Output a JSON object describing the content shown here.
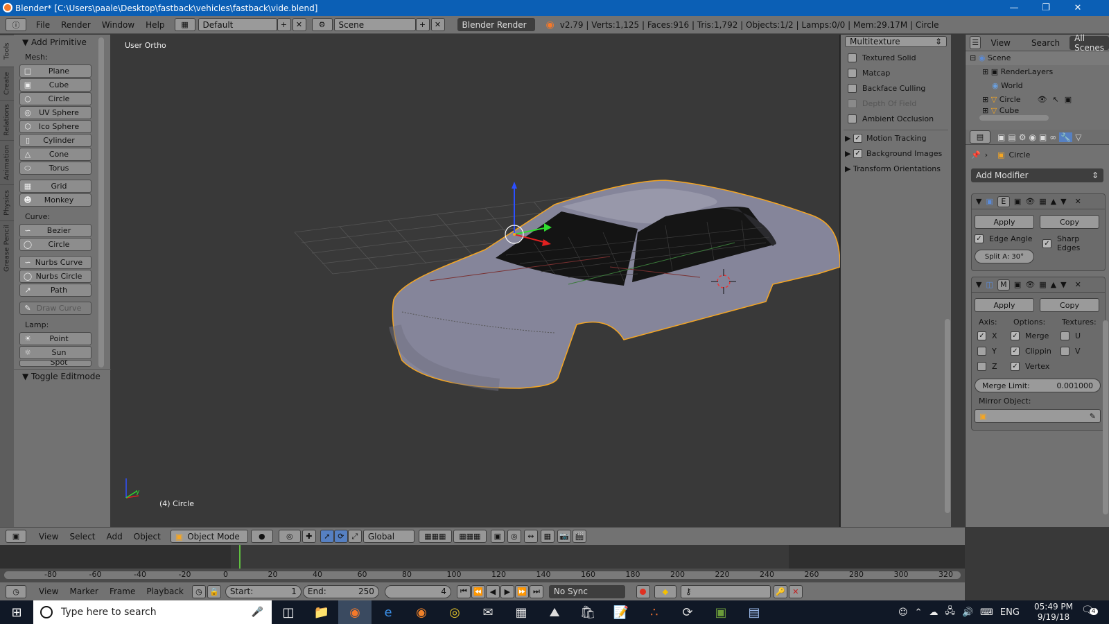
{
  "window": {
    "title": "Blender* [C:\\Users\\paale\\Desktop\\fastback\\vehicles\\fastback\\vide.blend]"
  },
  "info_header": {
    "menus": [
      "File",
      "Render",
      "Window",
      "Help"
    ],
    "layout": "Default",
    "scene": "Scene",
    "engine": "Blender Render",
    "stats": "v2.79 | Verts:1,125 | Faces:916 | Tris:1,792 | Objects:1/2 | Lamps:0/0 | Mem:29.17M | Circle"
  },
  "tool_tabs": [
    "Tools",
    "Create",
    "Relations",
    "Animation",
    "Physics",
    "Grease Pencil"
  ],
  "tool_shelf": {
    "title": "Add Primitive",
    "mesh_label": "Mesh:",
    "mesh": [
      "Plane",
      "Cube",
      "Circle",
      "UV Sphere",
      "Ico Sphere",
      "Cylinder",
      "Cone",
      "Torus"
    ],
    "mesh2": [
      "Grid",
      "Monkey"
    ],
    "curve_label": "Curve:",
    "curve": [
      "Bezier",
      "Circle"
    ],
    "curve2": [
      "Nurbs Curve",
      "Nurbs Circle",
      "Path"
    ],
    "draw_curve": "Draw Curve",
    "lamp_label": "Lamp:",
    "lamp": [
      "Point",
      "Sun",
      "Spot"
    ],
    "toggle_editmode": "Toggle Editmode"
  },
  "viewport": {
    "view_name": "User Ortho",
    "object_info": "(4) Circle",
    "colors": {
      "background": "#393939",
      "selection_outline": "#f5a623",
      "mesh": "#8a8a99"
    }
  },
  "shading_panel": {
    "shading_mode": "Multitexture",
    "options": [
      {
        "label": "Textured Solid",
        "checked": false,
        "disabled": false
      },
      {
        "label": "Matcap",
        "checked": false,
        "disabled": false
      },
      {
        "label": "Backface Culling",
        "checked": false,
        "disabled": false
      },
      {
        "label": "Depth Of Field",
        "checked": false,
        "disabled": true
      },
      {
        "label": "Ambient Occlusion",
        "checked": false,
        "disabled": false
      }
    ],
    "sections": [
      "Motion Tracking",
      "Background Images",
      "Transform Orientations"
    ]
  },
  "outliner": {
    "view": "View",
    "search": "Search",
    "filter": "All Scenes",
    "items": [
      "Scene",
      "RenderLayers",
      "World",
      "Circle",
      "Cube"
    ]
  },
  "properties": {
    "object": "Circle",
    "add_modifier": "Add Modifier",
    "edge_split": {
      "apply": "Apply",
      "copy": "Copy",
      "edge_angle": "Edge Angle",
      "sharp_edges": "Sharp Edges",
      "split_angle": "Split A: 30°"
    },
    "mirror": {
      "apply": "Apply",
      "copy": "Copy",
      "axis_label": "Axis:",
      "options_label": "Options:",
      "textures_label": "Textures:",
      "axes": [
        {
          "label": "X",
          "checked": true
        },
        {
          "label": "Y",
          "checked": false
        },
        {
          "label": "Z",
          "checked": false
        }
      ],
      "options": [
        {
          "label": "Merge",
          "checked": true
        },
        {
          "label": "Clippin",
          "checked": true
        },
        {
          "label": "Vertex",
          "checked": true
        }
      ],
      "textures": [
        {
          "label": "U",
          "checked": false
        },
        {
          "label": "V",
          "checked": false
        }
      ],
      "merge_limit_label": "Merge Limit:",
      "merge_limit_value": "0.001000",
      "mirror_object_label": "Mirror Object:"
    }
  },
  "view3d_header": {
    "menus": [
      "View",
      "Select",
      "Add",
      "Object"
    ],
    "mode": "Object Mode",
    "orientation": "Global"
  },
  "timeline": {
    "ticks": [
      "-80",
      "-60",
      "-40",
      "-20",
      "0",
      "20",
      "40",
      "60",
      "80",
      "100",
      "120",
      "140",
      "160",
      "180",
      "200",
      "220",
      "240",
      "260",
      "280",
      "300",
      "320"
    ],
    "menus": [
      "View",
      "Marker",
      "Frame",
      "Playback"
    ],
    "start_label": "Start:",
    "start": "1",
    "end_label": "End:",
    "end": "250",
    "current": "4",
    "sync": "No Sync"
  },
  "taskbar": {
    "search_placeholder": "Type here to search",
    "language": "ENG",
    "time": "05:49 PM",
    "date": "9/19/18",
    "notifications": "4"
  }
}
